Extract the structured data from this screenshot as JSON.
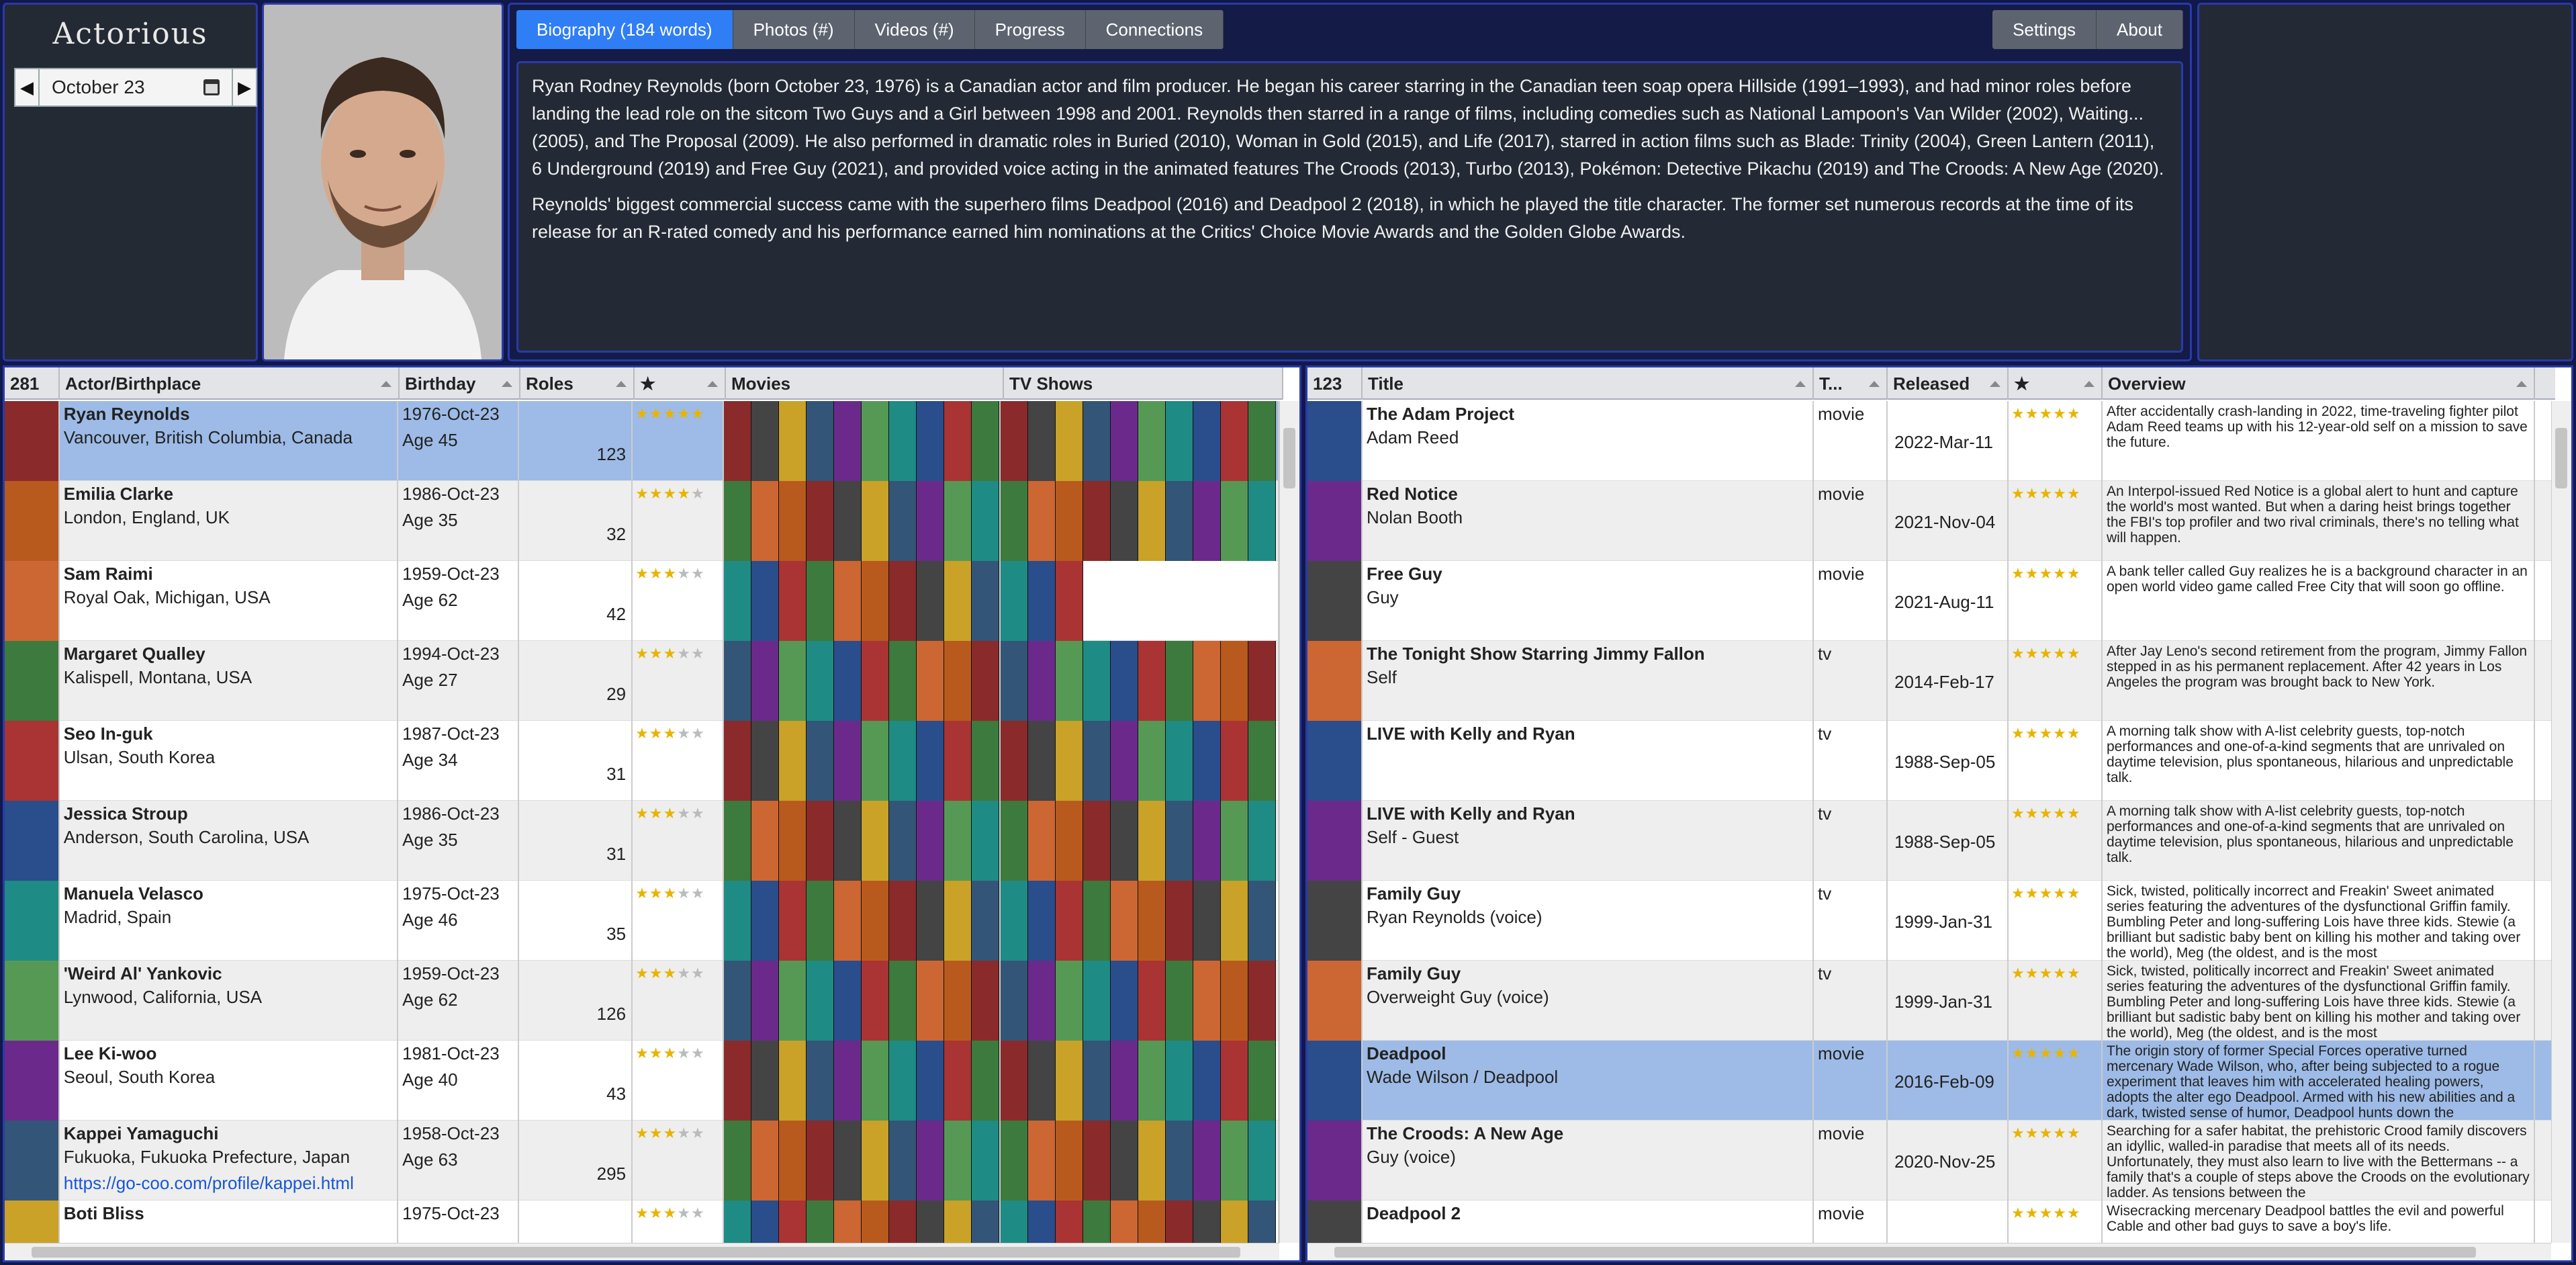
{
  "app": {
    "logo": "Actorious"
  },
  "date_picker": {
    "value": "October 23",
    "prev": "◀",
    "next": "▶"
  },
  "tabs": [
    {
      "label": "Biography (184 words)",
      "active": true
    },
    {
      "label": "Photos (#)"
    },
    {
      "label": "Videos (#)"
    },
    {
      "label": "Progress"
    },
    {
      "label": "Connections"
    }
  ],
  "tabs_right": [
    {
      "label": "Settings"
    },
    {
      "label": "About"
    }
  ],
  "bio": {
    "p1": "Ryan Rodney Reynolds (born October 23, 1976) is a Canadian actor and film producer. He began his career starring in the Canadian teen soap opera Hillside (1991–1993), and had minor roles before landing the lead role on the sitcom Two Guys and a Girl between 1998 and 2001. Reynolds then starred in a range of films, including comedies such as National Lampoon's Van Wilder (2002), Waiting... (2005), and The Proposal (2009). He also performed in dramatic roles in Buried (2010), Woman in Gold (2015), and Life (2017), starred in action films such as Blade: Trinity (2004), Green Lantern (2011), 6 Underground (2019) and Free Guy (2021), and provided voice acting in the animated features The Croods (2013), Turbo (2013), Pokémon: Detective Pikachu (2019) and The Croods: A New Age (2020).",
    "p2": "Reynolds' biggest commercial success came with the superhero films Deadpool (2016) and Deadpool 2 (2018), in which he played the title character. The former set numerous records at the time of its release for an R-rated comedy and his performance earned him nominations at the Critics' Choice Movie Awards and the Golden Globe Awards."
  },
  "actors": {
    "headers": {
      "count": "281",
      "name": "Actor/Birthplace",
      "birthday": "Birthday",
      "roles": "Roles",
      "star": "★",
      "movies": "Movies",
      "tv": "TV Shows"
    },
    "rows": [
      {
        "name": "Ryan Reynolds",
        "place": "Vancouver, British Columbia, Canada",
        "birthday": "1976-Oct-23",
        "age": "Age 45",
        "roles": "123",
        "stars": 5,
        "selected": true
      },
      {
        "name": "Emilia Clarke",
        "place": "London, England, UK",
        "birthday": "1986-Oct-23",
        "age": "Age 35",
        "roles": "32",
        "stars": 4
      },
      {
        "name": "Sam Raimi",
        "place": "Royal Oak, Michigan, USA",
        "birthday": "1959-Oct-23",
        "age": "Age 62",
        "roles": "42",
        "stars": 3
      },
      {
        "name": "Margaret Qualley",
        "place": "Kalispell, Montana, USA",
        "birthday": "1994-Oct-23",
        "age": "Age 27",
        "roles": "29",
        "stars": 3
      },
      {
        "name": "Seo In-guk",
        "place": "Ulsan, South Korea",
        "birthday": "1987-Oct-23",
        "age": "Age 34",
        "roles": "31",
        "stars": 3
      },
      {
        "name": "Jessica Stroup",
        "place": "Anderson, South Carolina, USA",
        "birthday": "1986-Oct-23",
        "age": "Age 35",
        "roles": "31",
        "stars": 3
      },
      {
        "name": "Manuela Velasco",
        "place": "Madrid, Spain",
        "birthday": "1975-Oct-23",
        "age": "Age 46",
        "roles": "35",
        "stars": 3
      },
      {
        "name": "'Weird Al' Yankovic",
        "place": "Lynwood, California, USA",
        "birthday": "1959-Oct-23",
        "age": "Age 62",
        "roles": "126",
        "stars": 3
      },
      {
        "name": "Lee Ki-woo",
        "place": "Seoul, South Korea",
        "birthday": "1981-Oct-23",
        "age": "Age 40",
        "roles": "43",
        "stars": 3
      },
      {
        "name": "Kappei Yamaguchi",
        "place": "Fukuoka, Fukuoka Prefecture, Japan",
        "link": "https://go-coo.com/profile/kappei.html",
        "birthday": "1958-Oct-23",
        "age": "Age 63",
        "roles": "295",
        "stars": 3
      },
      {
        "name": "Boti Bliss",
        "place": "",
        "birthday": "1975-Oct-23",
        "age": "",
        "roles": "",
        "stars": 3
      }
    ]
  },
  "titles": {
    "headers": {
      "count": "123",
      "title": "Title",
      "type": "T...",
      "released": "Released",
      "star": "★",
      "overview": "Overview"
    },
    "rows": [
      {
        "title": "The Adam Project",
        "role": "Adam Reed",
        "type": "movie",
        "released": "2022-Mar-11",
        "stars": 5,
        "overview": "After accidentally crash-landing in 2022, time-traveling fighter pilot Adam Reed teams up with his 12-year-old self on a mission to save the future."
      },
      {
        "title": "Red Notice",
        "role": "Nolan Booth",
        "type": "movie",
        "released": "2021-Nov-04",
        "stars": 5,
        "overview": "An Interpol-issued Red Notice is a global alert to hunt and capture the world's most wanted. But when a daring heist brings together the FBI's top profiler and two rival criminals, there's no telling what will happen."
      },
      {
        "title": "Free Guy",
        "role": "Guy",
        "type": "movie",
        "released": "2021-Aug-11",
        "stars": 5,
        "overview": "A bank teller called Guy realizes he is a background character in an open world video game called Free City that will soon go offline."
      },
      {
        "title": "The Tonight Show Starring Jimmy Fallon",
        "role": "Self",
        "type": "tv",
        "released": "2014-Feb-17",
        "stars": 5,
        "overview": "After Jay Leno's second retirement from the program, Jimmy Fallon stepped in as his permanent replacement. After 42 years in Los Angeles the program was brought back to New York."
      },
      {
        "title": "LIVE with Kelly and Ryan",
        "role": "",
        "type": "tv",
        "released": "1988-Sep-05",
        "stars": 5,
        "overview": "A morning talk show with A-list celebrity guests, top-notch performances and one-of-a-kind segments that are unrivaled on daytime television, plus spontaneous, hilarious and unpredictable talk."
      },
      {
        "title": "LIVE with Kelly and Ryan",
        "role": "Self - Guest",
        "type": "tv",
        "released": "1988-Sep-05",
        "stars": 5,
        "overview": "A morning talk show with A-list celebrity guests, top-notch performances and one-of-a-kind segments that are unrivaled on daytime television, plus spontaneous, hilarious and unpredictable talk."
      },
      {
        "title": "Family Guy",
        "role": "Ryan Reynolds (voice)",
        "type": "tv",
        "released": "1999-Jan-31",
        "stars": 5,
        "overview": "Sick, twisted, politically incorrect and Freakin' Sweet animated series featuring the adventures of the dysfunctional Griffin family. Bumbling Peter and long-suffering Lois have three kids. Stewie (a brilliant but sadistic baby bent on killing his mother and taking over the world), Meg (the oldest, and is the most"
      },
      {
        "title": "Family Guy",
        "role": "Overweight Guy (voice)",
        "type": "tv",
        "released": "1999-Jan-31",
        "stars": 5,
        "overview": "Sick, twisted, politically incorrect and Freakin' Sweet animated series featuring the adventures of the dysfunctional Griffin family. Bumbling Peter and long-suffering Lois have three kids. Stewie (a brilliant but sadistic baby bent on killing his mother and taking over the world), Meg (the oldest, and is the most"
      },
      {
        "title": "Deadpool",
        "role": "Wade Wilson / Deadpool",
        "type": "movie",
        "released": "2016-Feb-09",
        "stars": 5,
        "selected": true,
        "overview": "The origin story of former Special Forces operative turned mercenary Wade Wilson, who, after being subjected to a rogue experiment that leaves him with accelerated healing powers, adopts the alter ego Deadpool. Armed with his new abilities and a dark, twisted sense of humor, Deadpool hunts down the"
      },
      {
        "title": "The Croods: A New Age",
        "role": "Guy (voice)",
        "type": "movie",
        "released": "2020-Nov-25",
        "stars": 5,
        "overview": "Searching for a safer habitat, the prehistoric Crood family discovers an idyllic, walled-in paradise that meets all of its needs. Unfortunately, they must also learn to live with the Bettermans -- a family that's a couple of steps above the Croods on the evolutionary ladder. As tensions between the"
      },
      {
        "title": "Deadpool 2",
        "role": "",
        "type": "movie",
        "released": "",
        "stars": 5,
        "overview": "Wisecracking mercenary Deadpool battles the evil and powerful Cable and other bad guys to save a boy's life."
      }
    ]
  },
  "colors": {
    "accent": "#2f7ef5",
    "frame": "#2a3aa8",
    "selected_row": "#9dbbe6",
    "star": "#e8b400"
  },
  "icons": {
    "calendar": "calendar-icon",
    "prev": "chevron-left-icon",
    "next": "chevron-right-icon"
  }
}
